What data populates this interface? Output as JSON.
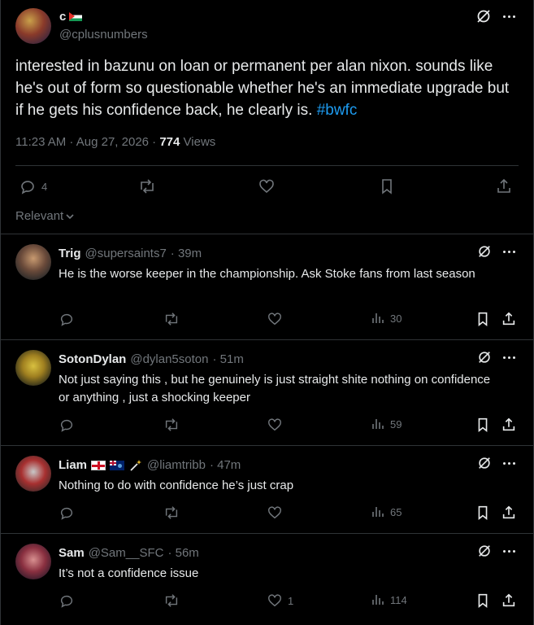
{
  "main_tweet": {
    "author_name": "c",
    "author_flag": "palestine-flag",
    "handle": "@cplusnumbers",
    "text": "interested in bazunu on loan or permanent per alan nixon. sounds like he's out of form so questionable whether he's an immediate upgrade but if he gets his confidence back, he clearly is.",
    "hashtag": "#bwfc",
    "time": "11:23 AM · Aug 27, 2026 · ",
    "views_count": "774",
    "views_label": " Views",
    "reply_count": "4",
    "sort_label": "Relevant"
  },
  "replies": [
    {
      "name": "Trig",
      "handle": "@supersaints7",
      "time": "· 39m",
      "text": "He is the worse keeper in the championship. Ask Stoke fans from last season",
      "likes": "",
      "views": "30"
    },
    {
      "name": "SotonDylan",
      "handle": "@dylan5soton",
      "time": "· 51m",
      "text": "Not just saying this , but he genuinely is just straight shite nothing on confidence or anything , just a shocking keeper",
      "likes": "",
      "views": "59"
    },
    {
      "name": "Liam",
      "handle": "@liamtribb",
      "time": "· 47m",
      "text": "Nothing to do with confidence he’s just crap",
      "likes": "",
      "views": "65"
    },
    {
      "name": "Sam",
      "handle": "@Sam__SFC",
      "time": "· 56m",
      "text": "It’s not a confidence issue",
      "likes": "1",
      "views": "114"
    }
  ],
  "colors": {
    "background": "#000000",
    "text": "#e7e9ea",
    "muted": "#71767b",
    "link": "#1d9bf0",
    "border": "#2f3336"
  }
}
